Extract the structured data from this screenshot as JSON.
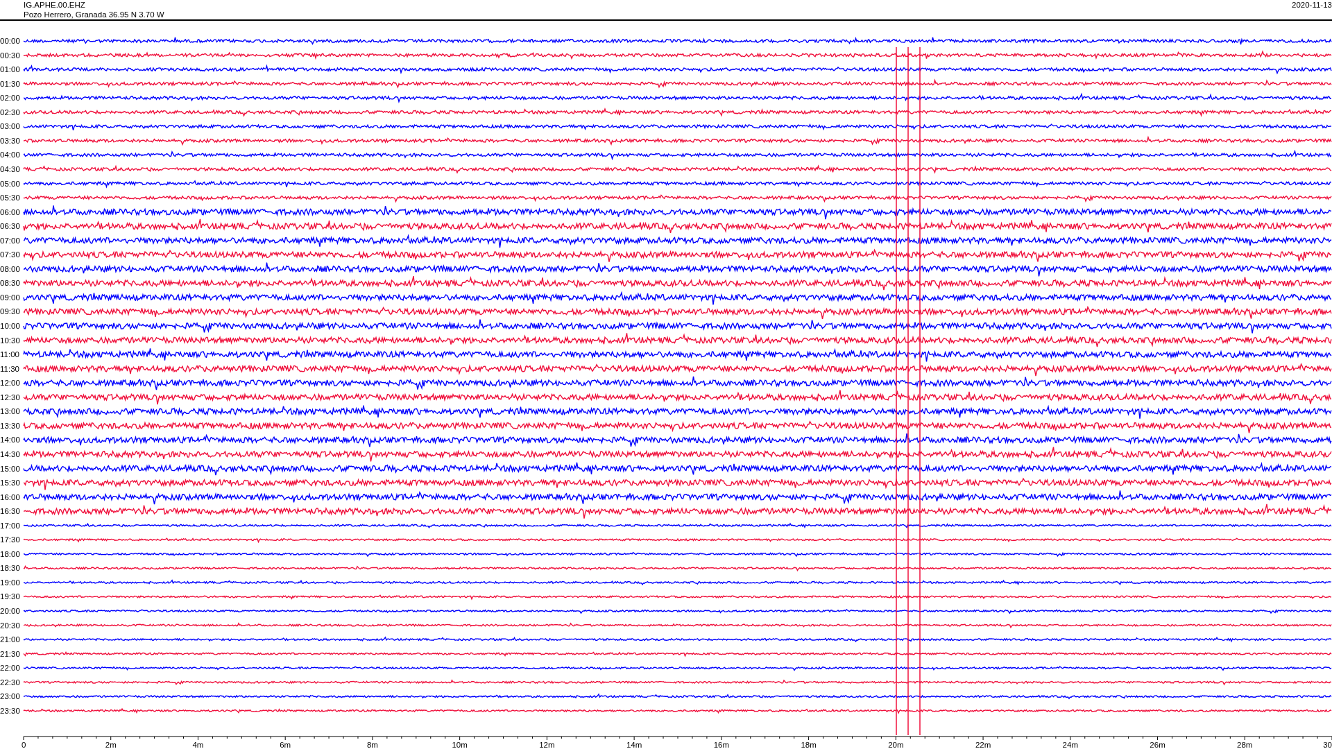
{
  "header": {
    "channel": "IG.APHE.00.EHZ",
    "station": "Pozo Herrero, Granada  36.95 N 3.70 W",
    "date": "2020-11-13"
  },
  "rows": [
    {
      "time": "00:00",
      "color": "#0000ff"
    },
    {
      "time": "00:30",
      "color": "#f0103c"
    },
    {
      "time": "01:00",
      "color": "#0000ff"
    },
    {
      "time": "01:30",
      "color": "#f0103c"
    },
    {
      "time": "02:00",
      "color": "#0000ff"
    },
    {
      "time": "02:30",
      "color": "#f0103c"
    },
    {
      "time": "03:00",
      "color": "#0000ff"
    },
    {
      "time": "03:30",
      "color": "#f0103c"
    },
    {
      "time": "04:00",
      "color": "#0000ff"
    },
    {
      "time": "04:30",
      "color": "#f0103c"
    },
    {
      "time": "05:00",
      "color": "#0000ff"
    },
    {
      "time": "05:30",
      "color": "#f0103c"
    },
    {
      "time": "06:00",
      "color": "#0000ff"
    },
    {
      "time": "06:30",
      "color": "#f0103c"
    },
    {
      "time": "07:00",
      "color": "#0000ff"
    },
    {
      "time": "07:30",
      "color": "#f0103c"
    },
    {
      "time": "08:00",
      "color": "#0000ff"
    },
    {
      "time": "08:30",
      "color": "#f0103c"
    },
    {
      "time": "09:00",
      "color": "#0000ff"
    },
    {
      "time": "09:30",
      "color": "#f0103c"
    },
    {
      "time": "10:00",
      "color": "#0000ff"
    },
    {
      "time": "10:30",
      "color": "#f0103c"
    },
    {
      "time": "11:00",
      "color": "#0000ff"
    },
    {
      "time": "11:30",
      "color": "#f0103c"
    },
    {
      "time": "12:00",
      "color": "#0000ff"
    },
    {
      "time": "12:30",
      "color": "#f0103c"
    },
    {
      "time": "13:00",
      "color": "#0000ff"
    },
    {
      "time": "13:30",
      "color": "#f0103c"
    },
    {
      "time": "14:00",
      "color": "#0000ff"
    },
    {
      "time": "14:30",
      "color": "#f0103c"
    },
    {
      "time": "15:00",
      "color": "#0000ff"
    },
    {
      "time": "15:30",
      "color": "#f0103c"
    },
    {
      "time": "16:00",
      "color": "#0000ff"
    },
    {
      "time": "16:30",
      "color": "#f0103c"
    },
    {
      "time": "17:00",
      "color": "#0000ff"
    },
    {
      "time": "17:30",
      "color": "#f0103c"
    },
    {
      "time": "18:00",
      "color": "#0000ff"
    },
    {
      "time": "18:30",
      "color": "#f0103c"
    },
    {
      "time": "19:00",
      "color": "#0000ff"
    },
    {
      "time": "19:30",
      "color": "#f0103c"
    },
    {
      "time": "20:00",
      "color": "#0000ff"
    },
    {
      "time": "20:30",
      "color": "#f0103c"
    },
    {
      "time": "21:00",
      "color": "#0000ff"
    },
    {
      "time": "21:30",
      "color": "#f0103c"
    },
    {
      "time": "22:00",
      "color": "#0000ff"
    },
    {
      "time": "22:30",
      "color": "#f0103c"
    },
    {
      "time": "23:00",
      "color": "#0000ff"
    },
    {
      "time": "23:30",
      "color": "#f0103c"
    }
  ],
  "axis_labels": [
    "0",
    "2m",
    "4m",
    "6m",
    "8m",
    "10m",
    "12m",
    "14m",
    "16m",
    "18m",
    "20m",
    "22m",
    "24m",
    "26m",
    "28m",
    "30"
  ]
}
